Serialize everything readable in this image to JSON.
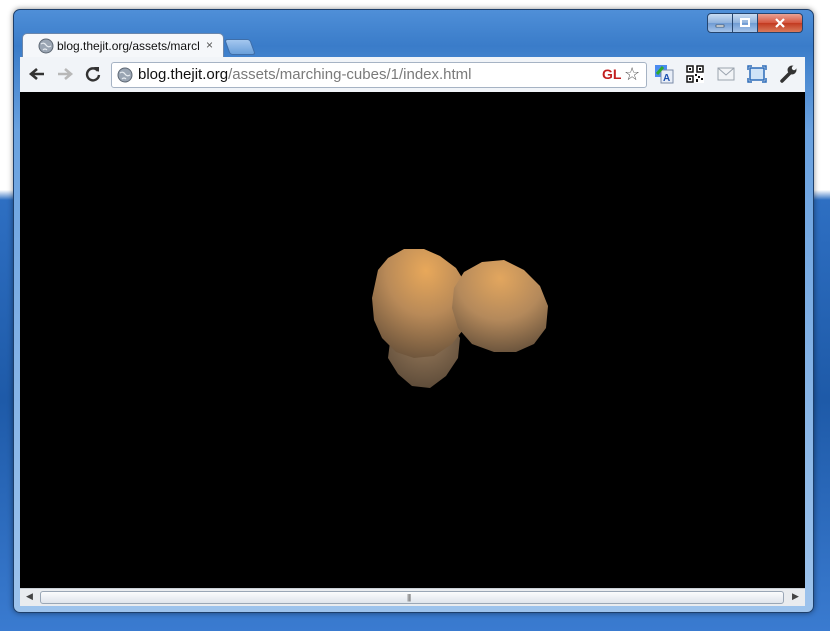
{
  "browser": {
    "tab": {
      "title": "blog.thejit.org/assets/marcl",
      "close_label": "×"
    },
    "address_bar": {
      "url_host": "blog.thejit.org",
      "url_path": "/assets/marching-cubes/1/index.html"
    },
    "gl_badge": "GL",
    "icons": {
      "back": "back-arrow-icon",
      "forward": "forward-arrow-icon",
      "reload": "reload-icon",
      "globe": "globe-icon",
      "bookmark": "star-icon",
      "translate": "translate-icon",
      "qr": "qr-code-icon",
      "mail": "mail-icon",
      "fullscreen": "fullscreen-icon",
      "wrench": "wrench-icon"
    }
  },
  "scrollbar": {
    "grip": "|||"
  },
  "colors": {
    "canvas_background": "#000000",
    "blob_light": "#e8a85a",
    "blob_dark": "#5e4a36"
  }
}
